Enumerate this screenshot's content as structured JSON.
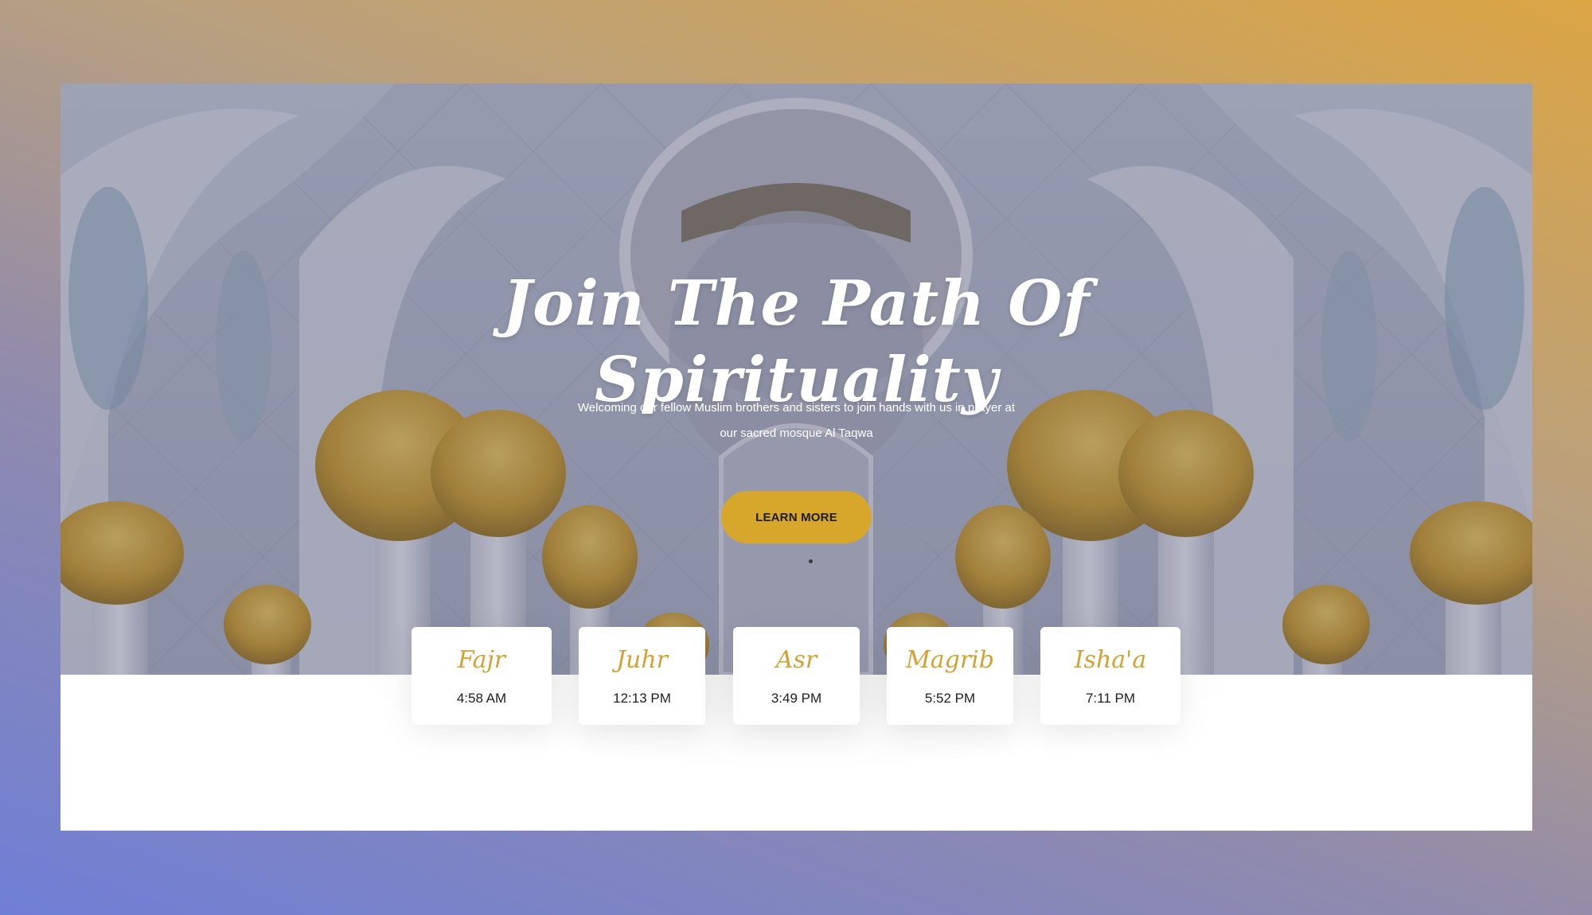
{
  "hero": {
    "title_line1": "Join The Path Of",
    "title_line2": "Spirituality",
    "subtitle_line1": "Welcoming our fellow Muslim brothers and sisters to join hands with us in prayer at",
    "subtitle_line2": "our sacred mosque Al Taqwa",
    "cta_label": "LEARN MORE"
  },
  "prayer_times": [
    {
      "name": "Fajr",
      "time": "4:58 AM"
    },
    {
      "name": "Juhr",
      "time": "12:13 PM"
    },
    {
      "name": "Asr",
      "time": "3:49 PM"
    },
    {
      "name": "Magrib",
      "time": "5:52 PM"
    },
    {
      "name": "Isha'a",
      "time": "7:11 PM"
    }
  ],
  "colors": {
    "accent_gold": "#d6a72b",
    "prayer_name_gold": "#d2a233",
    "background_gradient_start": "#6f7fd6",
    "background_gradient_end": "#dba544"
  },
  "background_image": "mosque-interior-photo"
}
